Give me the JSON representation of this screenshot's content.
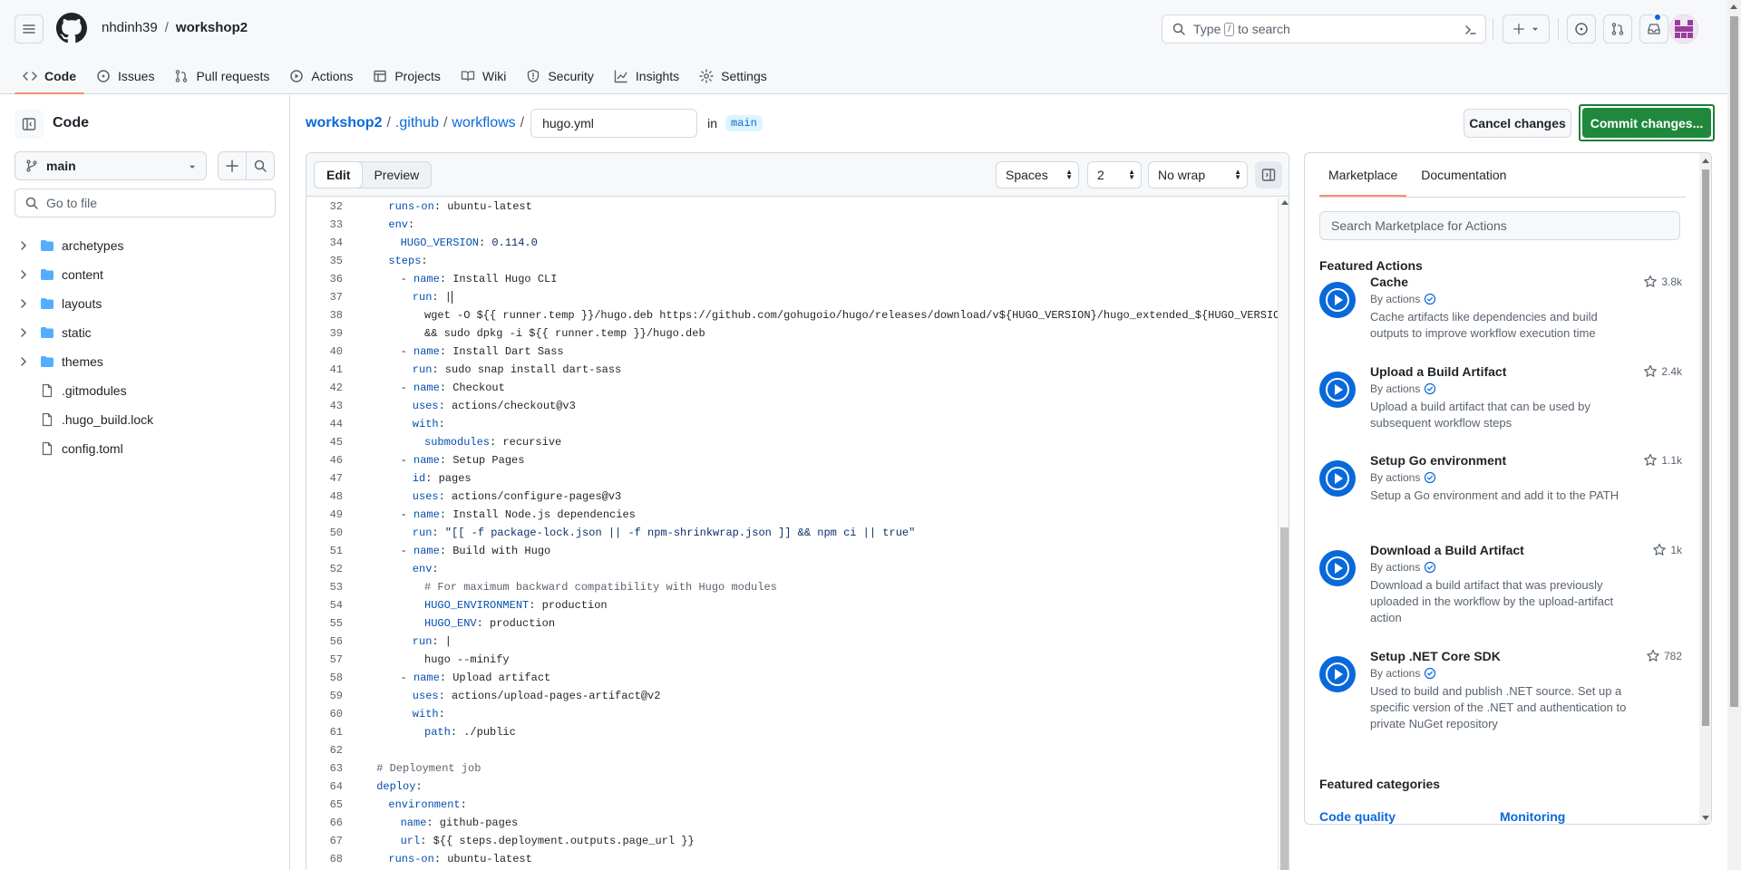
{
  "header": {
    "owner": "nhdinh39",
    "separator": "/",
    "repo": "workshop2",
    "search": {
      "placeholder_before": "Type",
      "key": "/",
      "placeholder_after": "to search"
    }
  },
  "repo_nav": [
    {
      "label": "Code",
      "icon": "code-icon",
      "active": true
    },
    {
      "label": "Issues",
      "icon": "issue-icon"
    },
    {
      "label": "Pull requests",
      "icon": "pull-request-icon"
    },
    {
      "label": "Actions",
      "icon": "play-icon"
    },
    {
      "label": "Projects",
      "icon": "table-icon"
    },
    {
      "label": "Wiki",
      "icon": "book-icon"
    },
    {
      "label": "Security",
      "icon": "shield-icon"
    },
    {
      "label": "Insights",
      "icon": "graph-icon"
    },
    {
      "label": "Settings",
      "icon": "gear-icon"
    }
  ],
  "sidebar": {
    "title": "Code",
    "branch": "main",
    "go_to_file": "Go to file",
    "tree": [
      {
        "name": "archetypes",
        "type": "folder"
      },
      {
        "name": "content",
        "type": "folder"
      },
      {
        "name": "layouts",
        "type": "folder"
      },
      {
        "name": "static",
        "type": "folder"
      },
      {
        "name": "themes",
        "type": "folder"
      },
      {
        "name": ".gitmodules",
        "type": "file"
      },
      {
        "name": ".hugo_build.lock",
        "type": "file"
      },
      {
        "name": "config.toml",
        "type": "file"
      }
    ]
  },
  "editor": {
    "breadcrumbs": [
      "workshop2",
      ".github",
      "workflows"
    ],
    "crumb_sep": "/",
    "filename": "hugo.yml",
    "in_label": "in",
    "branch": "main",
    "cancel_label": "Cancel changes",
    "commit_label": "Commit changes...",
    "mode_edit": "Edit",
    "mode_preview": "Preview",
    "indent_mode": "Spaces",
    "indent_size": "2",
    "wrap_mode": "No wrap",
    "lines": [
      {
        "n": "32",
        "i": 2,
        "k": "runs-on",
        "v": " ubuntu-latest"
      },
      {
        "n": "33",
        "i": 2,
        "k": "env",
        "v": ""
      },
      {
        "n": "34",
        "i": 3,
        "k": "HUGO_VERSION",
        "v": " 0.114.0",
        "vs": true
      },
      {
        "n": "35",
        "i": 2,
        "k": "steps",
        "v": ""
      },
      {
        "n": "36",
        "i": 3,
        "d": true,
        "k": "name",
        "v": " Install Hugo CLI"
      },
      {
        "n": "37",
        "i": 4,
        "k": "run",
        "v": " |",
        "cursor": true
      },
      {
        "n": "38",
        "i": 5,
        "raw": "wget -O ${{ runner.temp }}/hugo.deb https://github.com/gohugoio/hugo/releases/download/v${HUGO_VERSION}/hugo_extended_${HUGO_VERSION}_linux-a"
      },
      {
        "n": "39",
        "i": 5,
        "raw": "&& sudo dpkg -i ${{ runner.temp }}/hugo.deb"
      },
      {
        "n": "40",
        "i": 3,
        "d": true,
        "k": "name",
        "v": " Install Dart Sass"
      },
      {
        "n": "41",
        "i": 4,
        "k": "run",
        "v": " sudo snap install dart-sass"
      },
      {
        "n": "42",
        "i": 3,
        "d": true,
        "k": "name",
        "v": " Checkout"
      },
      {
        "n": "43",
        "i": 4,
        "k": "uses",
        "v": " actions/checkout@v3"
      },
      {
        "n": "44",
        "i": 4,
        "k": "with",
        "v": ""
      },
      {
        "n": "45",
        "i": 5,
        "k": "submodules",
        "v": " recursive"
      },
      {
        "n": "46",
        "i": 3,
        "d": true,
        "k": "name",
        "v": " Setup Pages"
      },
      {
        "n": "47",
        "i": 4,
        "k": "id",
        "v": " pages"
      },
      {
        "n": "48",
        "i": 4,
        "k": "uses",
        "v": " actions/configure-pages@v3"
      },
      {
        "n": "49",
        "i": 3,
        "d": true,
        "k": "name",
        "v": " Install Node.js dependencies"
      },
      {
        "n": "50",
        "i": 4,
        "k": "run",
        "v": " \"[[ -f package-lock.json || -f npm-shrinkwrap.json ]] && npm ci || true\"",
        "vs": true
      },
      {
        "n": "51",
        "i": 3,
        "d": true,
        "k": "name",
        "v": " Build with Hugo"
      },
      {
        "n": "52",
        "i": 4,
        "k": "env",
        "v": ""
      },
      {
        "n": "53",
        "i": 5,
        "c": "# For maximum backward compatibility with Hugo modules"
      },
      {
        "n": "54",
        "i": 5,
        "k": "HUGO_ENVIRONMENT",
        "v": " production"
      },
      {
        "n": "55",
        "i": 5,
        "k": "HUGO_ENV",
        "v": " production"
      },
      {
        "n": "56",
        "i": 4,
        "k": "run",
        "v": " |"
      },
      {
        "n": "57",
        "i": 5,
        "raw": "hugo --minify"
      },
      {
        "n": "58",
        "i": 3,
        "d": true,
        "k": "name",
        "v": " Upload artifact"
      },
      {
        "n": "59",
        "i": 4,
        "k": "uses",
        "v": " actions/upload-pages-artifact@v2"
      },
      {
        "n": "60",
        "i": 4,
        "k": "with",
        "v": ""
      },
      {
        "n": "61",
        "i": 5,
        "k": "path",
        "v": " ./public"
      },
      {
        "n": "62",
        "i": 0,
        "raw": ""
      },
      {
        "n": "63",
        "i": 1,
        "c": "# Deployment job"
      },
      {
        "n": "64",
        "i": 1,
        "k": "deploy",
        "v": ""
      },
      {
        "n": "65",
        "i": 2,
        "k": "environment",
        "v": ""
      },
      {
        "n": "66",
        "i": 3,
        "k": "name",
        "v": " github-pages"
      },
      {
        "n": "67",
        "i": 3,
        "k": "url",
        "v": " ${{ steps.deployment.outputs.page_url }}"
      },
      {
        "n": "68",
        "i": 2,
        "k": "runs-on",
        "v": " ubuntu-latest"
      }
    ]
  },
  "marketplace": {
    "tabs": [
      "Marketplace",
      "Documentation"
    ],
    "search_placeholder": "Search Marketplace for Actions",
    "featured_title": "Featured Actions",
    "actions": [
      {
        "name": "Cache",
        "by": "By actions",
        "stars": "3.8k",
        "desc": "Cache artifacts like dependencies and build outputs to improve workflow execution time"
      },
      {
        "name": "Upload a Build Artifact",
        "by": "By actions",
        "stars": "2.4k",
        "desc": "Upload a build artifact that can be used by subsequent workflow steps"
      },
      {
        "name": "Setup Go environment",
        "by": "By actions",
        "stars": "1.1k",
        "desc": "Setup a Go environment and add it to the PATH"
      },
      {
        "name": "Download a Build Artifact",
        "by": "By actions",
        "stars": "1k",
        "desc": "Download a build artifact that was previously uploaded in the workflow by the upload-artifact action"
      },
      {
        "name": "Setup .NET Core SDK",
        "by": "By actions",
        "stars": "782",
        "desc": "Used to build and publish .NET source. Set up a specific version of the .NET and authentication to private NuGet repository"
      }
    ],
    "categories_title": "Featured categories",
    "categories": [
      "Code quality",
      "Monitoring"
    ]
  },
  "colors": {
    "accent": "#0969da",
    "commit": "#1f883d",
    "tab_underline": "#fd8c73"
  }
}
